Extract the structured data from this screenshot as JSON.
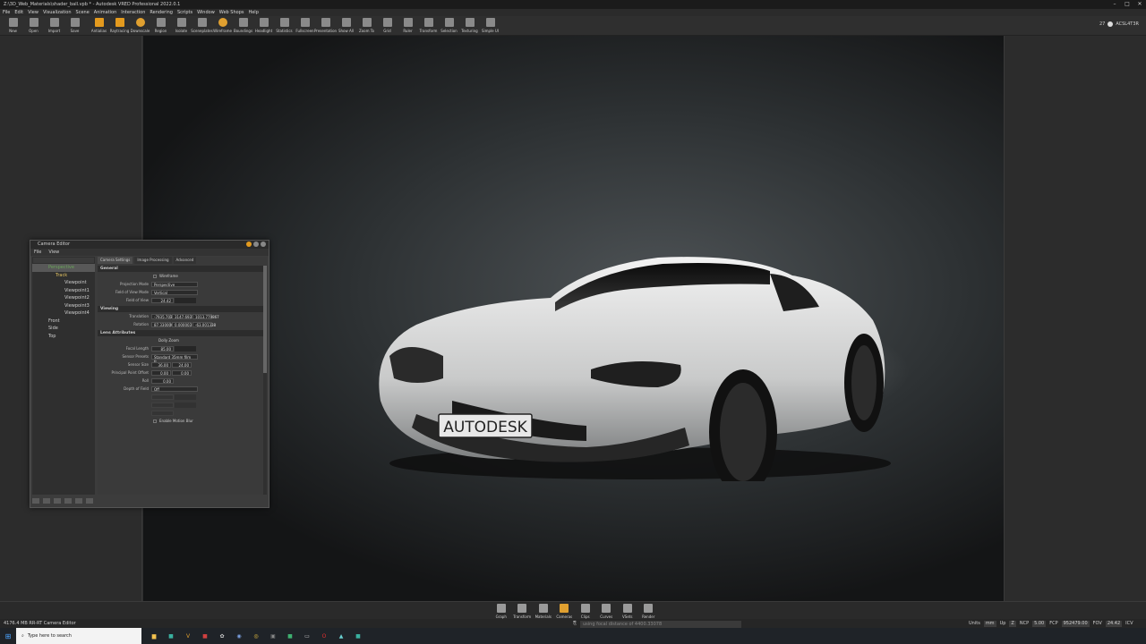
{
  "window": {
    "title": "Z:\\3D_Web_Materials\\shader_ball.vpb * - Autodesk VRED Professional 2022.0.1"
  },
  "menu": [
    "File",
    "Edit",
    "View",
    "Visualization",
    "Scene",
    "Animation",
    "Interaction",
    "Rendering",
    "Scripts",
    "Window",
    "Web Shops",
    "Help"
  ],
  "toolbar": [
    {
      "label": "New",
      "icon": "new-icon"
    },
    {
      "label": "Open",
      "icon": "open-icon"
    },
    {
      "label": "Import",
      "icon": "import-icon"
    },
    {
      "label": "Save",
      "icon": "save-icon"
    },
    {
      "label": "Antialias",
      "icon": "antialias-icon"
    },
    {
      "label": "Raytracing",
      "icon": "raytracing-icon"
    },
    {
      "label": "Downscale",
      "icon": "downscale-icon"
    },
    {
      "label": "Region",
      "icon": "region-icon"
    },
    {
      "label": "Isolate",
      "icon": "isolate-icon"
    },
    {
      "label": "Sceneplates",
      "icon": "sceneplates-icon"
    },
    {
      "label": "Wireframe",
      "icon": "wireframe-icon"
    },
    {
      "label": "Boundings",
      "icon": "boundings-icon"
    },
    {
      "label": "Headlight",
      "icon": "headlight-icon"
    },
    {
      "label": "Statistics",
      "icon": "statistics-icon"
    },
    {
      "label": "Fullscreen",
      "icon": "fullscreen-icon"
    },
    {
      "label": "Presentation",
      "icon": "presentation-icon"
    },
    {
      "label": "Show All",
      "icon": "show-all-icon"
    },
    {
      "label": "Zoom To",
      "icon": "zoom-to-icon"
    },
    {
      "label": "Grid",
      "icon": "grid-icon"
    },
    {
      "label": "Ruler",
      "icon": "ruler-icon"
    },
    {
      "label": "Transform",
      "icon": "transform-icon"
    },
    {
      "label": "Selection",
      "icon": "selection-icon"
    },
    {
      "label": "Texturing",
      "icon": "texturing-icon"
    },
    {
      "label": "Simple UI",
      "icon": "simple-ui-icon"
    }
  ],
  "render_status": {
    "count": "27",
    "colorspace": "ACSL4T3R"
  },
  "viewport": {
    "license_plate": "AUTODESK"
  },
  "camera_editor": {
    "title": "Camera Editor",
    "menu": [
      "File",
      "View"
    ],
    "tree": {
      "root": "Perspective",
      "track": "Track",
      "viewpoints": [
        "Viewpoint",
        "Viewpoint1",
        "Viewpoint2",
        "Viewpoint3",
        "Viewpoint4"
      ],
      "others": [
        "Front",
        "Side",
        "Top"
      ]
    },
    "tabs": [
      "Camera Settings",
      "Image Processing",
      "Advanced"
    ],
    "general": {
      "header": "General",
      "wireframe": "Wireframe",
      "projection_mode_label": "Projection Mode",
      "projection_mode": "Perspective",
      "fov_mode_label": "Field of View Mode",
      "fov_mode": "Vertical",
      "fov_label": "Field of View",
      "fov": "24.42"
    },
    "viewing": {
      "header": "Viewing",
      "translation_label": "Translation",
      "translation": [
        "-7935.703586",
        "3147.693129",
        "1013.779867"
      ],
      "rotation_label": "Rotation",
      "rotation": [
        "87.330000",
        "0.000003",
        "-63.001338"
      ]
    },
    "lens": {
      "header": "Lens Attributes",
      "dolly_zoom": "Dolly Zoom",
      "focal_length_label": "Focal Length",
      "focal_length": "85.00",
      "sensor_presets_label": "Sensor Presets",
      "sensor_presets": "Standard 35mm film fr...",
      "sensor_size_label": "Sensor Size",
      "sensor_size": [
        "36.00",
        "24.00"
      ],
      "principal_point_label": "Principal Point Offset",
      "principal_point": [
        "0.00",
        "0.00"
      ],
      "roll_label": "Roll",
      "roll": "0.00",
      "dof_label": "Depth of Field",
      "dof": "Off",
      "motion_blur": "Enable Motion Blur"
    }
  },
  "modules": [
    {
      "label": "Graph",
      "icon": "graph-icon"
    },
    {
      "label": "Transform",
      "icon": "transform-icon"
    },
    {
      "label": "Materials",
      "icon": "materials-icon"
    },
    {
      "label": "Cameras",
      "icon": "cameras-icon"
    },
    {
      "label": "Clips",
      "icon": "clips-icon"
    },
    {
      "label": "Curves",
      "icon": "curves-icon"
    },
    {
      "label": "VSets",
      "icon": "vsets-icon"
    },
    {
      "label": "Render",
      "icon": "render-icon"
    }
  ],
  "statusbar": {
    "memory": "4176.4 MB  RR-RT  Camera Editor",
    "command": "using focal distance of 4400.33078",
    "units_label": "Units",
    "units": "mm",
    "up_label": "Up",
    "up": "Z",
    "ncp_label": "NCP",
    "ncp": "5.00",
    "fcp_label": "FCP",
    "fcp": "952479.00",
    "fov_label": "FOV",
    "fov": "24.42",
    "icv": "ICV"
  },
  "taskbar": {
    "search_placeholder": "Type here to search"
  }
}
